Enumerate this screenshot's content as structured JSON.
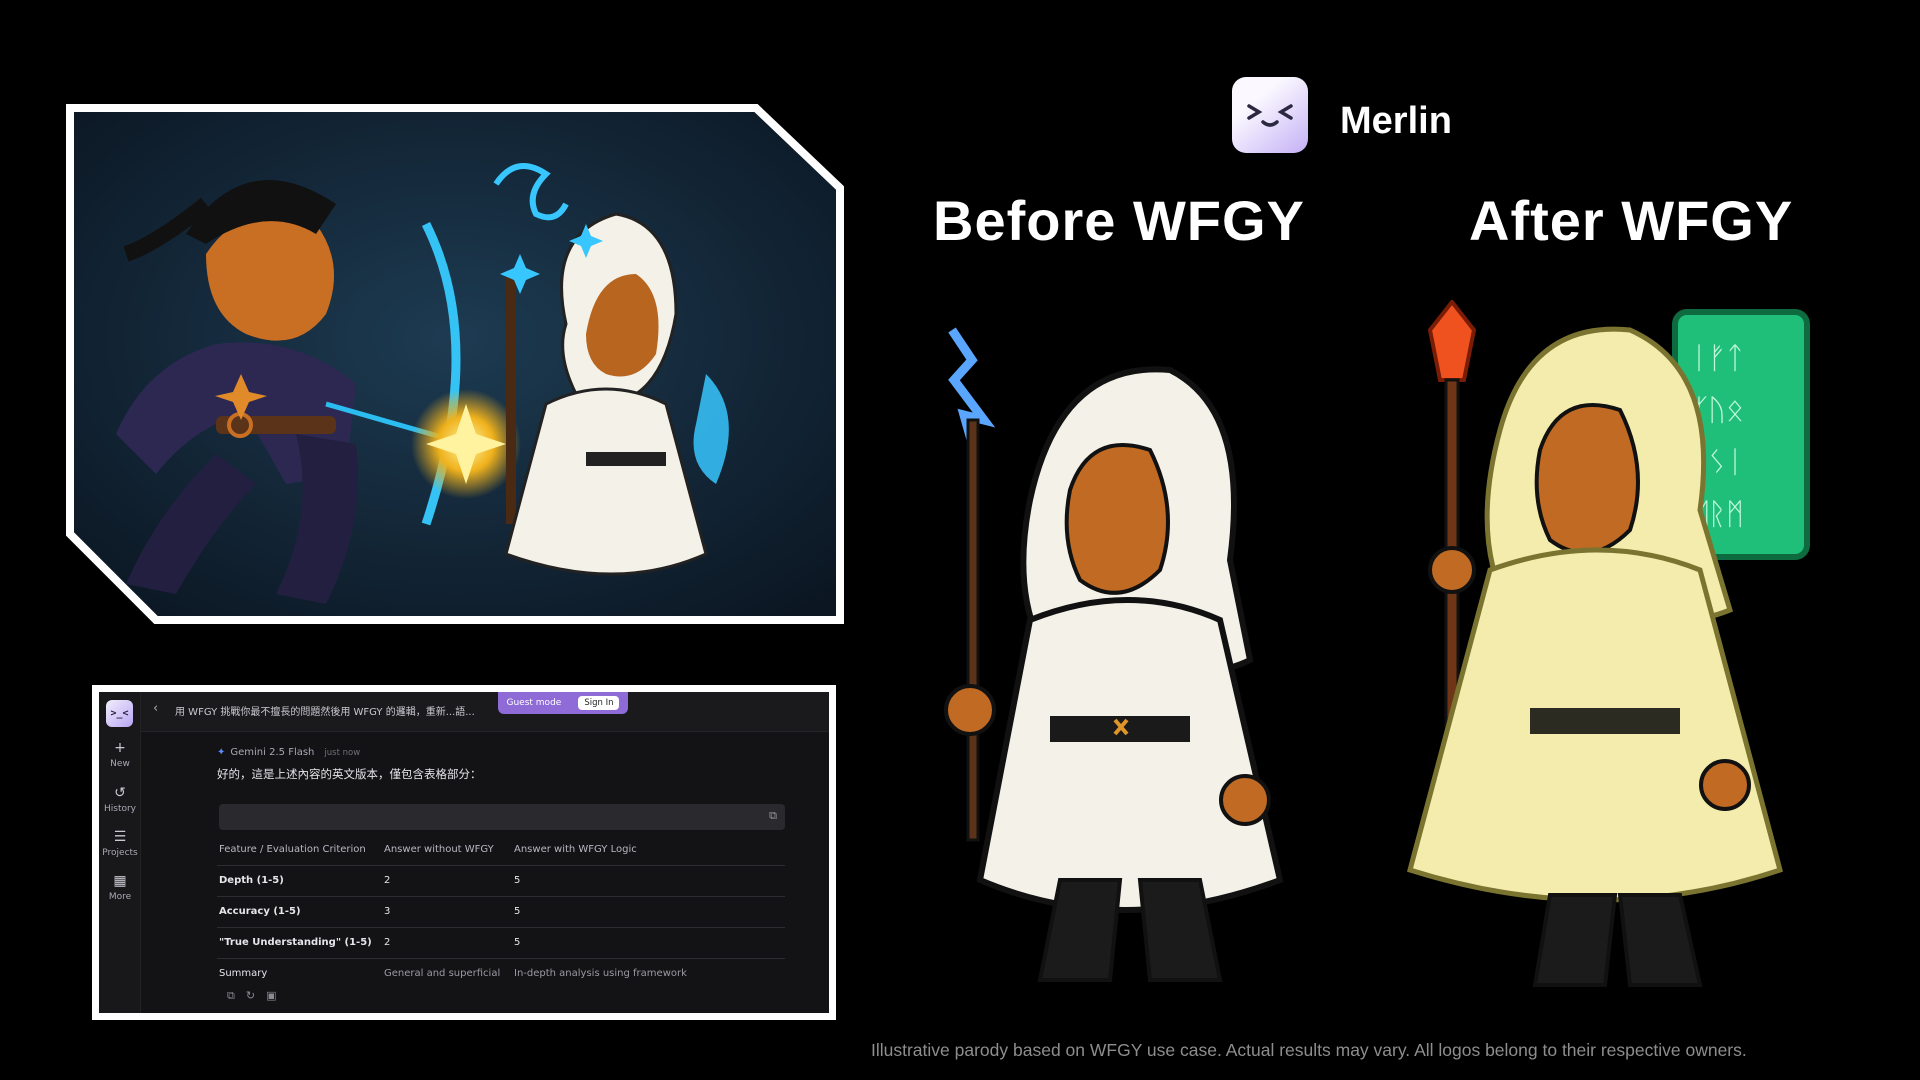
{
  "brand": {
    "name": "Merlin",
    "logo_glyph": ">_<"
  },
  "comparison": {
    "before_label": "Before WFGY",
    "after_label": "After WFGY"
  },
  "disclaimer": "Illustrative parody based on WFGY use case. Actual results may vary. All logos belong to their respective owners.",
  "chat_app": {
    "logo_glyph": ">_<",
    "sidebar": [
      {
        "icon": "plus-icon",
        "label": "New"
      },
      {
        "icon": "history-icon",
        "label": "History"
      },
      {
        "icon": "layers-icon",
        "label": "Projects"
      },
      {
        "icon": "grid-icon",
        "label": "More"
      }
    ],
    "breadcrumb": "用 WFGY 挑戰你最不擅長的問題然後用 WFGY 的邏輯，重新...語...",
    "guest_mode": "Guest mode",
    "sign_in": "Sign In",
    "model": "Gemini 2.5 Flash",
    "timestamp": "just now",
    "message_lead": "好的，這是上述內容的英文版本，僅包含表格部分：",
    "table": {
      "headers": [
        "Feature / Evaluation Criterion",
        "Answer without WFGY",
        "Answer with WFGY Logic"
      ],
      "rows": [
        [
          "Depth (1-5)",
          "2",
          "5"
        ],
        [
          "Accuracy (1-5)",
          "3",
          "5"
        ],
        [
          "\"True Understanding\" (1-5)",
          "2",
          "5"
        ],
        [
          "Summary",
          "General and superficial",
          "In-depth analysis using framework"
        ]
      ]
    }
  }
}
